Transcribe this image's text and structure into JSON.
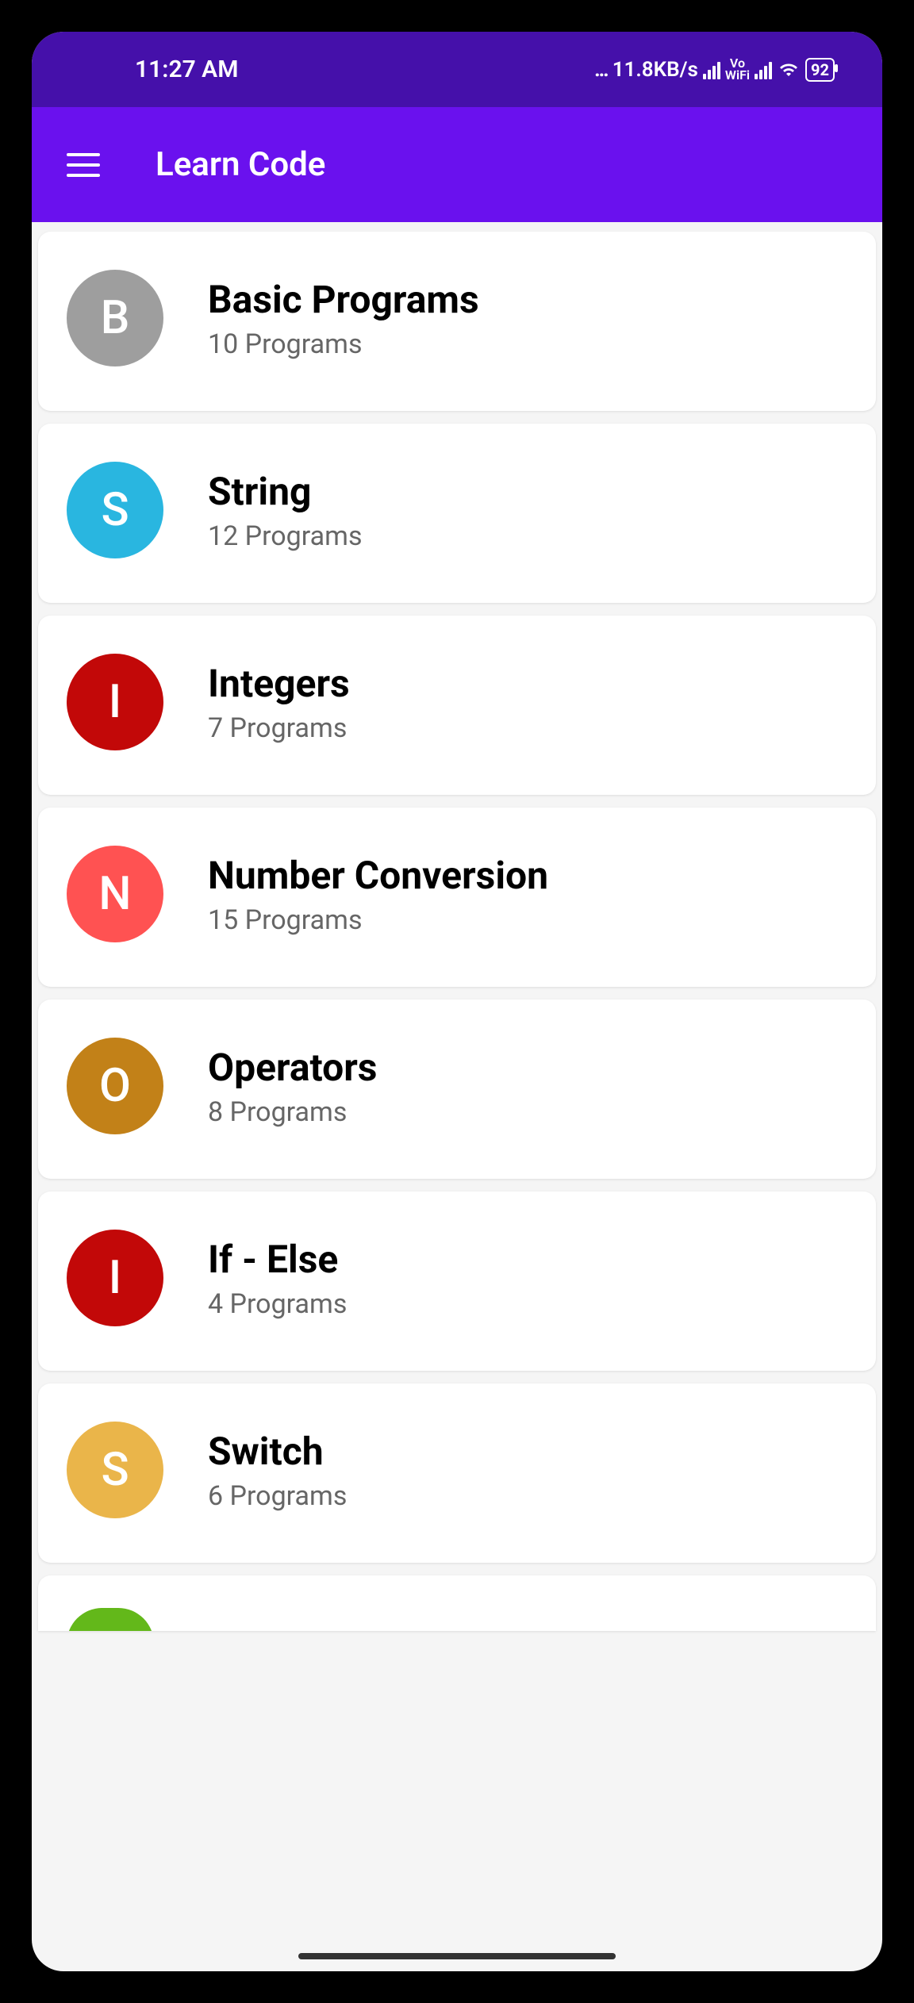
{
  "statusBar": {
    "time": "11:27 AM",
    "dataSpeed": "11.8KB/s",
    "voWifi": "Vo\nWiFi",
    "battery": "92"
  },
  "appBar": {
    "title": "Learn Code"
  },
  "categories": [
    {
      "letter": "B",
      "title": "Basic Programs",
      "subtitle": "10 Programs",
      "color": "#9e9e9e"
    },
    {
      "letter": "S",
      "title": "String",
      "subtitle": "12 Programs",
      "color": "#29b6e0"
    },
    {
      "letter": "I",
      "title": "Integers",
      "subtitle": "7 Programs",
      "color": "#c20808"
    },
    {
      "letter": "N",
      "title": "Number Conversion",
      "subtitle": "15 Programs",
      "color": "#ff5252"
    },
    {
      "letter": "O",
      "title": "Operators",
      "subtitle": "8 Programs",
      "color": "#c28118"
    },
    {
      "letter": "I",
      "title": "If - Else",
      "subtitle": "4 Programs",
      "color": "#c20808"
    },
    {
      "letter": "S",
      "title": "Switch",
      "subtitle": "6 Programs",
      "color": "#eab54a"
    }
  ],
  "peek": {
    "color": "#63b81a"
  }
}
